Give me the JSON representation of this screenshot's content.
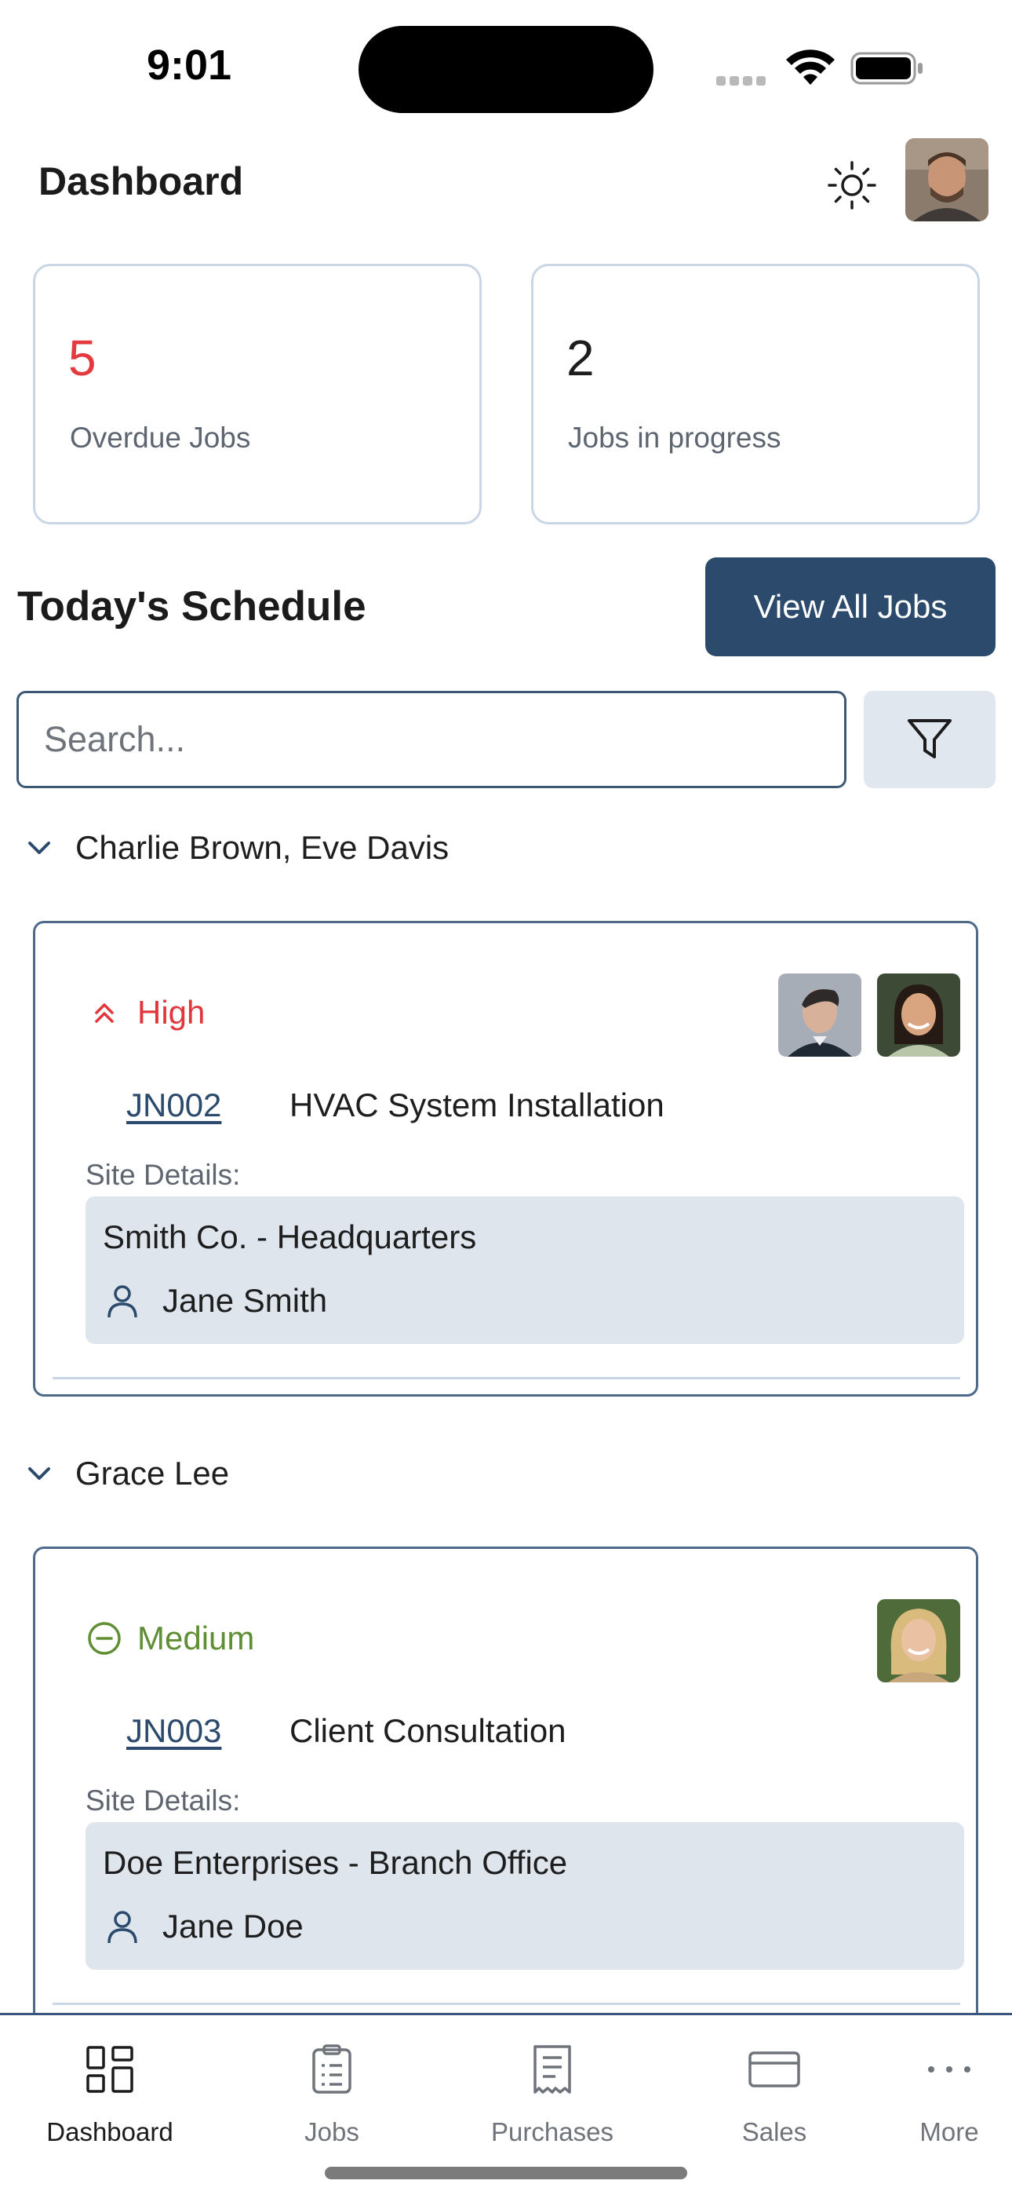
{
  "status_bar": {
    "time": "9:01"
  },
  "header": {
    "title": "Dashboard",
    "theme_icon": "sun-icon"
  },
  "stats": [
    {
      "value": "5",
      "label": "Overdue Jobs",
      "color": "#e13a3f"
    },
    {
      "value": "2",
      "label": "Jobs in progress",
      "color": "#1d1d1d"
    }
  ],
  "schedule": {
    "title": "Today's Schedule",
    "view_all_label": "View All Jobs",
    "search_placeholder": "Search...",
    "search_value": "",
    "groups": [
      {
        "title": "Charlie Brown, Eve Davis",
        "job": {
          "priority": "High",
          "priority_icon": "double-chevron-up-icon",
          "priority_color": "#e0373c",
          "number": "JN002",
          "name": "HVAC System Installation",
          "site_label": "Site Details:",
          "site_name": "Smith Co. - Headquarters",
          "contact": "Jane Smith"
        }
      },
      {
        "title": "Grace Lee",
        "job": {
          "priority": "Medium",
          "priority_icon": "minus-circle-icon",
          "priority_color": "#5f8f32",
          "number": "JN003",
          "name": "Client Consultation",
          "site_label": "Site Details:",
          "site_name": "Doe Enterprises - Branch Office",
          "contact": "Jane Doe"
        }
      }
    ]
  },
  "nav": {
    "items": [
      {
        "label": "Dashboard",
        "icon": "grid-icon",
        "active": true
      },
      {
        "label": "Jobs",
        "icon": "clipboard-icon",
        "active": false
      },
      {
        "label": "Purchases",
        "icon": "receipt-icon",
        "active": false
      },
      {
        "label": "Sales",
        "icon": "credit-card-icon",
        "active": false
      },
      {
        "label": "More",
        "icon": "more-dots-icon",
        "active": false
      }
    ]
  },
  "colors": {
    "primary": "#2c4a6c",
    "card_border": "#c9d6e6",
    "site_box": "#dee5ed"
  }
}
